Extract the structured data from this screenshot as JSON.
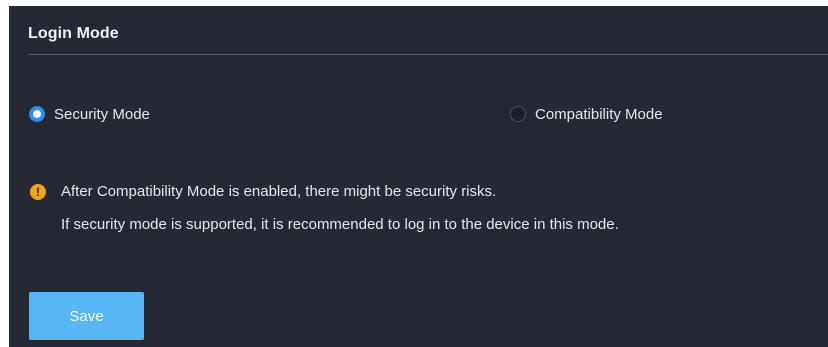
{
  "section": {
    "title": "Login Mode"
  },
  "login_mode": {
    "options": [
      {
        "label": "Security Mode",
        "selected": true
      },
      {
        "label": "Compatibility Mode",
        "selected": false
      }
    ]
  },
  "notice": {
    "icon": "exclamation-icon",
    "icon_glyph": "!",
    "icon_color": "#f3a31a",
    "line1": "After Compatibility Mode is enabled, there might be security risks.",
    "line2": "If security mode is supported, it is recommended to log in to the device in this mode."
  },
  "actions": {
    "save_label": "Save"
  },
  "colors": {
    "panel_background": "#262933",
    "accent": "#2d8cf0",
    "save_button": "#58b6f5"
  }
}
